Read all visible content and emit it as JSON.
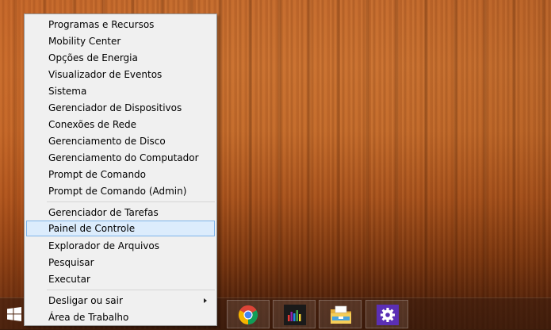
{
  "context_menu": {
    "group1": [
      "Programas e Recursos",
      "Mobility Center",
      "Opções de Energia",
      "Visualizador de Eventos",
      "Sistema",
      "Gerenciador de Dispositivos",
      "Conexões de Rede",
      "Gerenciamento de Disco",
      "Gerenciamento do Computador",
      "Prompt de Comando",
      "Prompt de Comando (Admin)"
    ],
    "group2": [
      "Gerenciador de Tarefas",
      "Painel de Controle",
      "Explorador de Arquivos",
      "Pesquisar",
      "Executar"
    ],
    "group3": [
      "Desligar ou sair",
      "Área de Trabalho"
    ],
    "highlighted_item": "Painel de Controle"
  },
  "taskbar": {
    "icons": [
      "windows-logo-icon",
      "chrome-icon",
      "music-app-icon",
      "file-explorer-icon",
      "settings-icon"
    ]
  },
  "colors": {
    "menu_background": "#f0f0f0",
    "highlight_background": "#dcecfc",
    "highlight_border": "#7eb4ea",
    "settings_tile": "#5b2fb5"
  }
}
